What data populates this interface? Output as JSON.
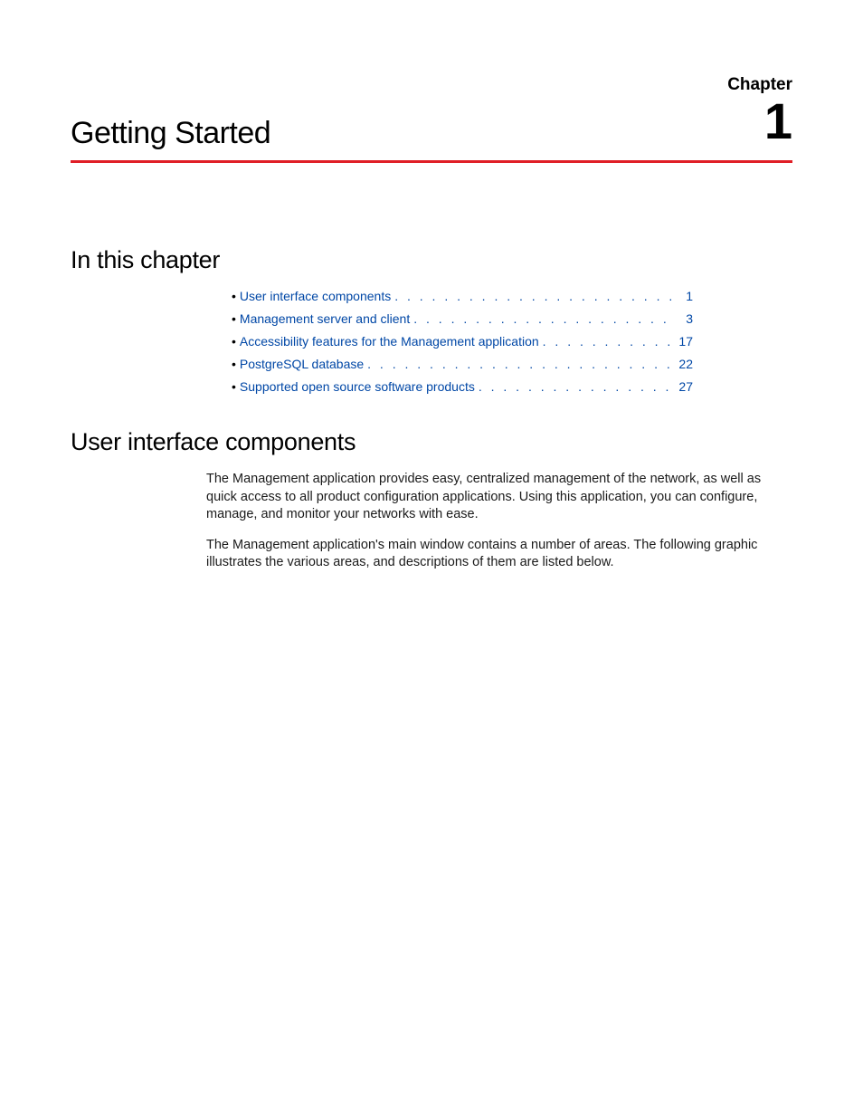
{
  "chapter": {
    "label": "Chapter",
    "number": "1",
    "title": "Getting Started"
  },
  "sections": {
    "in_this_chapter": "In this chapter",
    "user_interface_components": "User interface components"
  },
  "toc": [
    {
      "label": "User interface components",
      "page": "1"
    },
    {
      "label": "Management server and client",
      "page": "3"
    },
    {
      "label": "Accessibility features for the Management application",
      "page": "17"
    },
    {
      "label": "PostgreSQL database",
      "page": "22"
    },
    {
      "label": "Supported open source software products",
      "page": "27"
    }
  ],
  "body": {
    "p1": "The Management application provides easy, centralized management of the network, as well as quick access to all product configuration applications. Using this application, you can configure, manage, and monitor your networks with ease.",
    "p2": "The Management application's main window contains a number of areas. The following graphic illustrates the various areas, and descriptions of them are listed below."
  }
}
